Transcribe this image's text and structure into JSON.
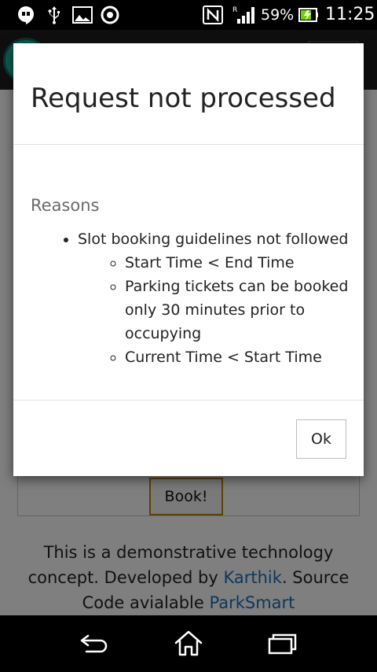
{
  "status_bar": {
    "icons": [
      "hangouts-icon",
      "usb-icon",
      "gallery-icon",
      "chrome-icon",
      "nfc-icon",
      "signal-icon",
      "battery-icon"
    ],
    "battery_percent": "59%",
    "time": "11:25"
  },
  "app": {
    "book_button": "Book!",
    "footer": {
      "text_1": "This is a demonstrative technology concept. Developed by ",
      "author_link": "Karthik",
      "text_2": ". Source Code avialable ",
      "source_link": "ParkSmart"
    }
  },
  "dialog": {
    "title": "Request not processed",
    "reasons_heading": "Reasons",
    "main_reason": "Slot booking guidelines not followed",
    "sub_reasons": [
      "Start Time < End Time",
      "Parking tickets can be booked only 30 minutes prior to occupying",
      "Current Time < Start Time"
    ],
    "ok_label": "Ok"
  },
  "nav_bar": {
    "buttons": [
      "back-icon",
      "home-icon",
      "recent-apps-icon"
    ]
  }
}
